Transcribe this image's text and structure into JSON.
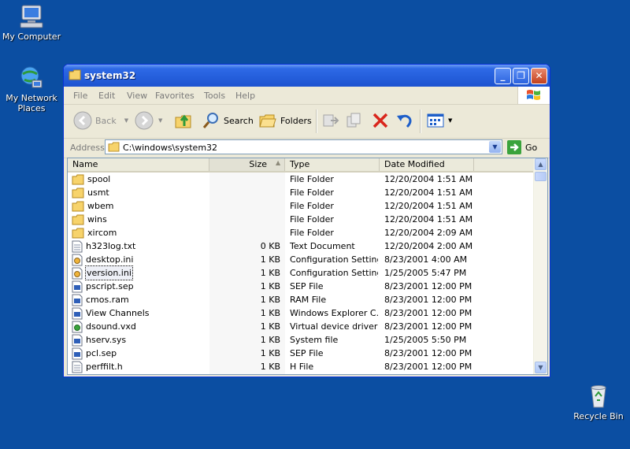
{
  "desktop": {
    "icons": [
      {
        "label": "My Computer",
        "icon": "my-computer-icon"
      },
      {
        "label": "My Network\nPlaces",
        "icon": "network-places-icon"
      },
      {
        "label": "Recycle Bin",
        "icon": "recycle-bin-icon"
      }
    ]
  },
  "window": {
    "title": "system32",
    "menu": [
      "File",
      "Edit",
      "View",
      "Favorites",
      "Tools",
      "Help"
    ],
    "toolbar": {
      "back": "Back",
      "search": "Search",
      "folders": "Folders"
    },
    "address": {
      "label": "Address",
      "value": "C:\\windows\\system32",
      "go": "Go"
    },
    "columns": [
      "Name",
      "Size",
      "Type",
      "Date Modified"
    ],
    "sort_column": "Size",
    "files": [
      {
        "name": "spool",
        "size": "",
        "type": "File Folder",
        "date": "12/20/2004 1:51 AM",
        "icon": "folder-icon"
      },
      {
        "name": "usmt",
        "size": "",
        "type": "File Folder",
        "date": "12/20/2004 1:51 AM",
        "icon": "folder-icon"
      },
      {
        "name": "wbem",
        "size": "",
        "type": "File Folder",
        "date": "12/20/2004 1:51 AM",
        "icon": "folder-icon"
      },
      {
        "name": "wins",
        "size": "",
        "type": "File Folder",
        "date": "12/20/2004 1:51 AM",
        "icon": "folder-icon"
      },
      {
        "name": "xircom",
        "size": "",
        "type": "File Folder",
        "date": "12/20/2004 2:09 AM",
        "icon": "folder-icon"
      },
      {
        "name": "h323log.txt",
        "size": "0 KB",
        "type": "Text Document",
        "date": "12/20/2004 2:00 AM",
        "icon": "text-file-icon"
      },
      {
        "name": "desktop.ini",
        "size": "1 KB",
        "type": "Configuration Settings",
        "date": "8/23/2001 4:00 AM",
        "icon": "config-file-icon"
      },
      {
        "name": "version.ini",
        "size": "1 KB",
        "type": "Configuration Settings",
        "date": "1/25/2005 5:47 PM",
        "icon": "config-file-icon"
      },
      {
        "name": "pscript.sep",
        "size": "1 KB",
        "type": "SEP File",
        "date": "8/23/2001 12:00 PM",
        "icon": "system-file-icon"
      },
      {
        "name": "cmos.ram",
        "size": "1 KB",
        "type": "RAM File",
        "date": "8/23/2001 12:00 PM",
        "icon": "system-file-icon"
      },
      {
        "name": "View Channels",
        "size": "1 KB",
        "type": "Windows Explorer C...",
        "date": "8/23/2001 12:00 PM",
        "icon": "system-file-icon"
      },
      {
        "name": "dsound.vxd",
        "size": "1 KB",
        "type": "Virtual device driver",
        "date": "8/23/2001 12:00 PM",
        "icon": "driver-file-icon"
      },
      {
        "name": "hserv.sys",
        "size": "1 KB",
        "type": "System file",
        "date": "1/25/2005 5:50 PM",
        "icon": "system-file-icon"
      },
      {
        "name": "pcl.sep",
        "size": "1 KB",
        "type": "SEP File",
        "date": "8/23/2001 12:00 PM",
        "icon": "system-file-icon"
      },
      {
        "name": "perffilt.h",
        "size": "1 KB",
        "type": "H File",
        "date": "8/23/2001 12:00 PM",
        "icon": "text-file-icon"
      }
    ],
    "focused_file": "version.ini"
  },
  "colors": {
    "desktop": "#0b4ea2",
    "titlebar": "#245edb",
    "close_button": "#c3401e"
  }
}
